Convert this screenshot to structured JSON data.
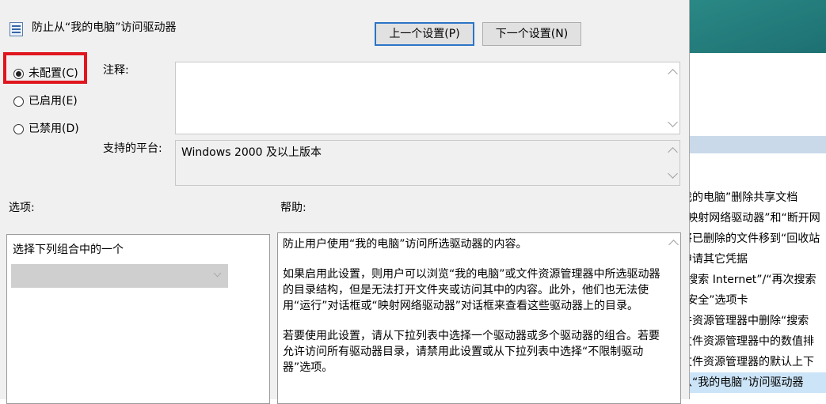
{
  "dialog": {
    "title": "防止从“我的电脑”访问驱动器",
    "prev_button": "上一个设置(P)",
    "next_button": "下一个设置(N)"
  },
  "state_options": [
    {
      "label": "未配置(C)",
      "selected": true
    },
    {
      "label": "已启用(E)",
      "selected": false
    },
    {
      "label": "已禁用(D)",
      "selected": false
    }
  ],
  "comment": {
    "label": "注释:",
    "value": ""
  },
  "platform": {
    "label": "支持的平台:",
    "value": "Windows 2000 及以上版本"
  },
  "options": {
    "label": "选项:",
    "instruction": "选择下列组合中的一个",
    "dropdown_value": ""
  },
  "help": {
    "label": "帮助:",
    "paragraphs": [
      "防止用户使用“我的电脑”访问所选驱动器的内容。",
      "如果启用此设置，则用户可以浏览“我的电脑”或文件资源管理器中所选驱动器的目录结构，但是无法打开文件夹或访问其中的内容。此外，他们也无法使用“运行”对话框或“映射网络驱动器”对话框来查看这些驱动器上的目录。",
      "若要使用此设置，请从下拉列表中选择一个驱动器或多个驱动器的组合。若要允许访问所有驱动器目录，请禁用此设置或从下拉列表中选择“不限制驱动器”选项。"
    ]
  },
  "background_list": [
    "我的电脑”删除共享文档",
    "“映射网络驱动器”和“断开网",
    "将已删除的文件移到“回收站",
    "申请其它凭据",
    "“搜索 Internet”/“再次搜索",
    "“安全”选项卡",
    "件资源管理器中删除“搜索",
    "文件资源管理器中的数值排",
    "文件资源管理器的默认上下",
    "从“我的电脑”访问驱动器"
  ]
}
